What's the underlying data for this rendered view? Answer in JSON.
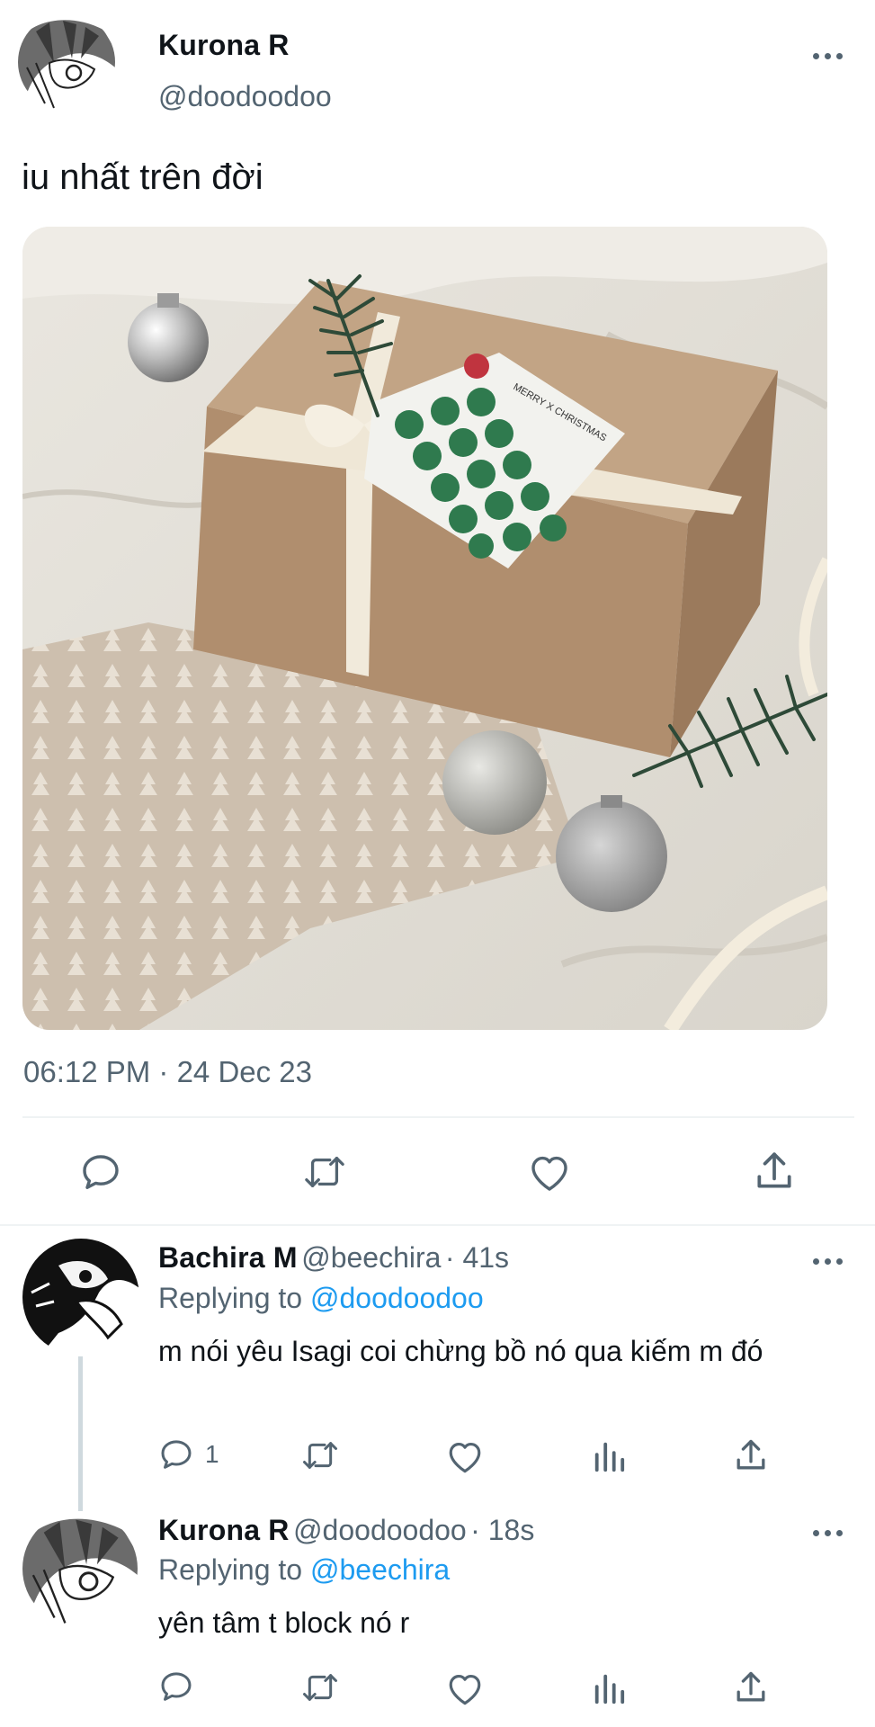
{
  "main_tweet": {
    "author_name": "Kurona R",
    "author_handle": "@doodoodoo",
    "text": "iu nhất trên đời",
    "timestamp": "06:12 PM · 24 Dec 23",
    "image_alt": "Kraft gift box with cream ribbon, pine sprig and green polka-dot Merry Christmas card, silver ornaments, on knit blanket",
    "card_text": "MERRY X CHRISTMAS",
    "actions": [
      "reply-icon",
      "retweet-icon",
      "like-icon",
      "share-icon"
    ]
  },
  "replies": [
    {
      "author_name": "Bachira M",
      "author_handle": "@beechira",
      "time": "· 41s",
      "replying_label": "Replying to",
      "replying_to": "@doodoodoo",
      "text": "m nói yêu Isagi coi chừng bồ nó qua kiếm m đó",
      "reply_count": "1"
    },
    {
      "author_name": "Kurona R",
      "author_handle": "@doodoodoo",
      "time": "· 18s",
      "replying_label": "Replying to",
      "replying_to": "@beechira",
      "text": "yên tâm t block nó r",
      "reply_count": ""
    }
  ],
  "colors": {
    "text": "#0f1419",
    "muted": "#536471",
    "link": "#1d9bf0",
    "divider": "#eff3f4"
  }
}
